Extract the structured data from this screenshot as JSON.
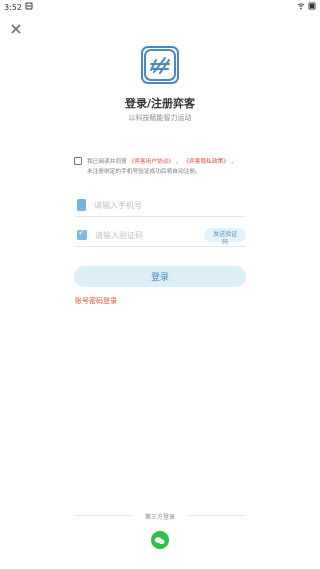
{
  "status_bar": {
    "time": "3:52",
    "notification_icon": "notification-icon",
    "wifi_icon": "wifi-icon",
    "battery_icon": "battery-icon"
  },
  "close_icon": "close-icon",
  "logo_icon": "app-logo-icon",
  "header": {
    "title": "登录/注册弈客",
    "subtitle": "以科技赋能智力运动"
  },
  "agreement": {
    "line1_prefix": "我已阅读并同意",
    "user_agreement": "《弈客用户协议》",
    "separator": "、",
    "privacy_policy": "《弈客隐私政策》",
    "line1_suffix": "，",
    "line2": "未注册绑定的手机号验证成功后将自动注册。"
  },
  "phone_field": {
    "placeholder": "请输入手机号",
    "icon": "phone-icon"
  },
  "code_field": {
    "placeholder": "请输入验证码",
    "icon": "verification-icon"
  },
  "send_code_label": "发送验证码",
  "login_button_label": "登录",
  "password_login_label": "账号密码登录",
  "third_party": {
    "label": "第三方登录",
    "wechat_icon": "wechat-icon"
  },
  "colors": {
    "accent": "#4a8ac4",
    "accent_light": "#dbeff9",
    "red": "#e24a3b",
    "wechat_green": "#2fbf4a"
  }
}
